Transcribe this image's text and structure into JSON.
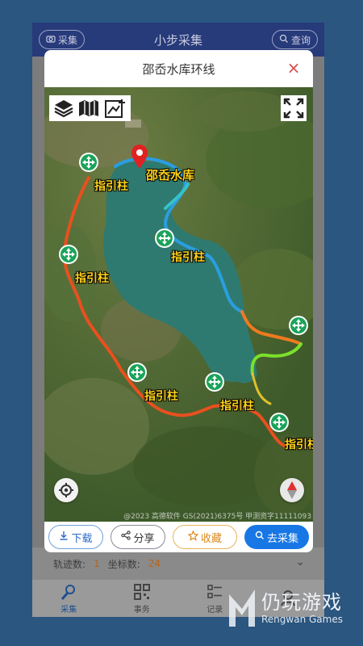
{
  "app": {
    "title": "小步采集",
    "left_button": "采集",
    "right_button": "查询"
  },
  "modal": {
    "title": "邵岙水库环线",
    "close_icon": "close-icon"
  },
  "map": {
    "reservoir_label": "邵岙水库",
    "guide_post_label": "指引柱",
    "copyright": "@2023 高德软件 GS(2021)6375号 甲测资字11111093",
    "toolbox_icons": [
      "layers-icon",
      "map-book-icon",
      "edit-map-icon"
    ],
    "fullscreen_icon": "fullscreen-icon",
    "locate_icon": "locate-icon",
    "compass_icon": "compass-icon",
    "water_color": "#2f7a70",
    "route_colors": [
      "#e8501e",
      "#2a9ee0",
      "#7be02a",
      "#36c2c9"
    ]
  },
  "actions": {
    "download": "下载",
    "share": "分享",
    "favorite": "收藏",
    "go_collect": "去采集"
  },
  "background": {
    "track_count_label": "轨迹数:",
    "track_count": "1",
    "coord_count_label": "坐标数:",
    "coord_count": "24"
  },
  "tabs": [
    {
      "label": "采集",
      "icon": "collect-icon",
      "active": true
    },
    {
      "label": "事务",
      "icon": "qr-icon",
      "active": false
    },
    {
      "label": "记录",
      "icon": "list-icon",
      "active": false
    },
    {
      "label": "",
      "icon": "profile-icon",
      "active": false
    }
  ],
  "watermark": {
    "cn": "仍玩游戏",
    "en": "Rengwan Games"
  }
}
